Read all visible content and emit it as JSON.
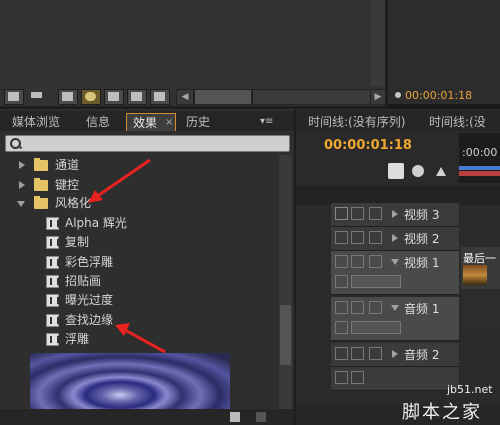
{
  "top": {
    "timecode": "00:00:01:18"
  },
  "effects_panel": {
    "tabs": [
      {
        "label": "媒体浏览",
        "active": false
      },
      {
        "label": "信息",
        "active": false
      },
      {
        "label": "效果",
        "active": true
      },
      {
        "label": "历史",
        "active": false
      }
    ],
    "tab_close": "×",
    "menu": "▾≡",
    "search_placeholder": "",
    "tree": [
      {
        "label": "通道",
        "type": "folder",
        "expanded": false
      },
      {
        "label": "键控",
        "type": "folder",
        "expanded": false
      },
      {
        "label": "风格化",
        "type": "folder",
        "expanded": true
      },
      {
        "label": "Alpha 辉光",
        "type": "effect"
      },
      {
        "label": "复制",
        "type": "effect"
      },
      {
        "label": "彩色浮雕",
        "type": "effect"
      },
      {
        "label": "招贴画",
        "type": "effect"
      },
      {
        "label": "曝光过度",
        "type": "effect"
      },
      {
        "label": "查找边缘",
        "type": "effect"
      },
      {
        "label": "浮雕",
        "type": "effect"
      }
    ]
  },
  "timeline_panel": {
    "tabs": [
      {
        "label": "时间线:(没有序列)"
      },
      {
        "label": "时间线:(没"
      }
    ],
    "timecode": "00:00:01:18",
    "ruler_label": ":00:00",
    "tracks": [
      {
        "label": "视频 3",
        "kind": "video"
      },
      {
        "label": "视频 2",
        "kind": "video"
      },
      {
        "label": "视频 1",
        "kind": "video",
        "expanded": true
      },
      {
        "label": "音频 1",
        "kind": "audio",
        "expanded": true
      },
      {
        "label": "音频 2",
        "kind": "audio"
      }
    ],
    "clip_title": "最后一"
  },
  "watermark": {
    "site": "jb51.net",
    "name": "脚本之家"
  },
  "colors": {
    "timecode": "#f0a830",
    "active_tab_border": "#d58a2c",
    "annotation_arrow": "#e8231f"
  }
}
